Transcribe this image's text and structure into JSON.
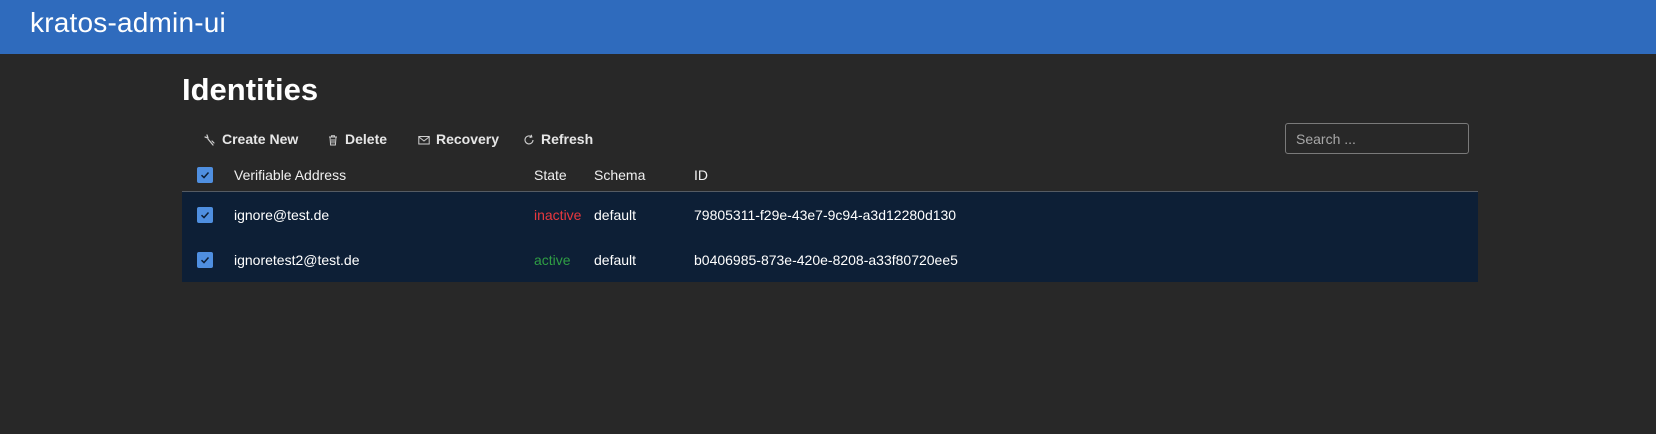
{
  "app": {
    "title": "kratos-admin-ui"
  },
  "page": {
    "title": "Identities"
  },
  "toolbar": {
    "create_label": "Create New",
    "delete_label": "Delete",
    "recovery_label": "Recovery",
    "refresh_label": "Refresh",
    "search_placeholder": "Search ..."
  },
  "table": {
    "columns": {
      "address": "Verifiable Address",
      "state": "State",
      "schema": "Schema",
      "id": "ID"
    },
    "rows": [
      {
        "address": "ignore@test.de",
        "state": "inactive",
        "schema": "default",
        "id": "79805311-f29e-43e7-9c94-a3d12280d130",
        "checked": true
      },
      {
        "address": "ignoretest2@test.de",
        "state": "active",
        "schema": "default",
        "id": "b0406985-873e-420e-8208-a33f80720ee5",
        "checked": true
      }
    ]
  },
  "colors": {
    "header_bg": "#2f6bbd",
    "page_bg": "#282828",
    "row_bg": "#0d1f36",
    "checkbox": "#4f8fe0",
    "inactive": "#e8383e",
    "active": "#2f9e44"
  },
  "icons": {
    "create": "sparkle-icon",
    "delete": "trash-icon",
    "recovery": "envelope-icon",
    "refresh": "refresh-icon",
    "checkbox": "checkmark-icon"
  }
}
